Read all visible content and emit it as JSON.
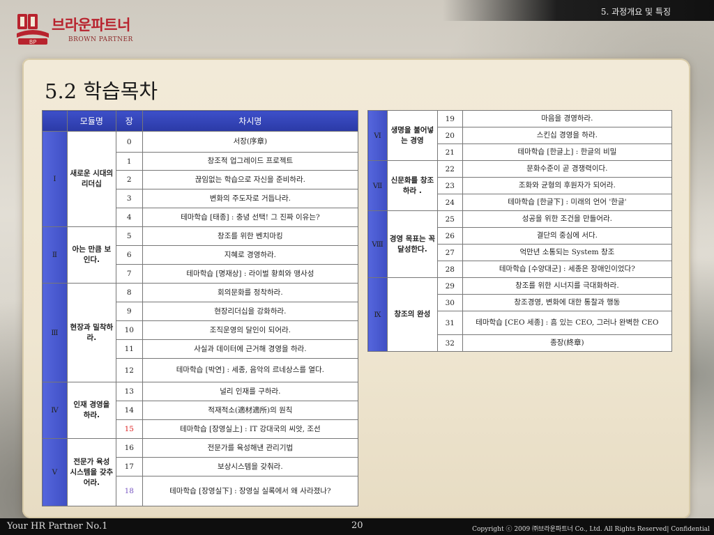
{
  "header": {
    "section_label": "5. 과정개요 및 특징",
    "logo_text_ko": "브라운파트너",
    "logo_text_en": "BROWN PARTNER",
    "logo_mark_text": "BP"
  },
  "page_title": "5.2 학습목차",
  "colors": {
    "header_blue": "#2b3aa6",
    "roman_blue": "#4a5bd3",
    "highlight_red": "#dd2222",
    "highlight_violet": "#7a59c2",
    "logo_red": "#b8232e"
  },
  "table_headers": {
    "module": "모듈명",
    "chapter": "장",
    "title": "차시명"
  },
  "modules": [
    {
      "numeral": "Ⅰ",
      "name": "새로운 시대의 리더십",
      "chapters": [
        {
          "no": "0",
          "title": "서장(序章)"
        },
        {
          "no": "1",
          "title": "창조적 업그레이드 프로젝트"
        },
        {
          "no": "2",
          "title": "끊임없는 학습으로 자신을 준비하라."
        },
        {
          "no": "3",
          "title": "변화의 주도자로 거듭나라."
        },
        {
          "no": "4",
          "title": "테마학습 [태종] : 충녕 선택! 그 진짜 이유는?"
        }
      ]
    },
    {
      "numeral": "Ⅱ",
      "name": "아는 만큼 보인다.",
      "chapters": [
        {
          "no": "5",
          "title": "창조를 위한 벤치마킹"
        },
        {
          "no": "6",
          "title": "지혜로 경영하라."
        },
        {
          "no": "7",
          "title": "테마학습 [명재상] : 라이벌 황희와 맹사성"
        }
      ]
    },
    {
      "numeral": "Ⅲ",
      "name": "현장과 밀착하라.",
      "chapters": [
        {
          "no": "8",
          "title": "회의문화를 정착하라."
        },
        {
          "no": "9",
          "title": "현장리더십을 강화하라."
        },
        {
          "no": "10",
          "title": "조직운영의 달인이 되어라."
        },
        {
          "no": "11",
          "title": "사실과 데이터에 근거해 경영을 하라."
        },
        {
          "no": "12",
          "title": "테마학습 [박연] : 세종, 음악의 르네상스를 열다."
        }
      ]
    },
    {
      "numeral": "Ⅳ",
      "name": "인재 경영을 하라.",
      "chapters": [
        {
          "no": "13",
          "title": "널리 인재를 구하라."
        },
        {
          "no": "14",
          "title": "적재적소(適材適所)의 원칙"
        },
        {
          "no": "15",
          "title": "테마학습 [장영실上] : IT 강대국의 씨앗, 조선",
          "color": "red"
        }
      ]
    },
    {
      "numeral": "Ⅴ",
      "name": "전문가 육성 시스템을 갖추어라.",
      "chapters": [
        {
          "no": "16",
          "title": "전문가를 육성해낸 관리기법"
        },
        {
          "no": "17",
          "title": "보상시스템을 갖춰라."
        },
        {
          "no": "18",
          "title": "테마학습 [장영실下] : 장영실 실록에서 왜 사라졌나?",
          "color": "violet"
        }
      ]
    },
    {
      "numeral": "Ⅵ",
      "name": "생명을 불어넣는 경영",
      "chapters": [
        {
          "no": "19",
          "title": "마음을 경영하라."
        },
        {
          "no": "20",
          "title": "스킨십 경영을 하라."
        },
        {
          "no": "21",
          "title": "테마학습 [한글上] : 한글의 비밀"
        }
      ]
    },
    {
      "numeral": "Ⅶ",
      "name": "신문화를 창조하라 .",
      "chapters": [
        {
          "no": "22",
          "title": "문화수준이 곧 경쟁력이다."
        },
        {
          "no": "23",
          "title": "조화와 균형의 후원자가 되어라."
        },
        {
          "no": "24",
          "title": "테마학습 [한글下] : 미래의 언어 '한글'"
        }
      ]
    },
    {
      "numeral": "Ⅷ",
      "name": "경영 목표는 꼭 달성한다.",
      "chapters": [
        {
          "no": "25",
          "title": "성공을 위한 조건을 만들어라."
        },
        {
          "no": "26",
          "title": "결단의 중심에 서다."
        },
        {
          "no": "27",
          "title": "억만년 소통되는 System 창조"
        },
        {
          "no": "28",
          "title": "테마학습 [수양대군] : 세종은 장애인이었다?"
        }
      ]
    },
    {
      "numeral": "Ⅸ",
      "name": "창조의 완성",
      "chapters": [
        {
          "no": "29",
          "title": "창조를 위한 시너지를 극대화하라."
        },
        {
          "no": "30",
          "title": "창조경영, 변화에 대한 통찰과 행동"
        },
        {
          "no": "31",
          "title": "테마학습 [CEO 세종] : 흠 있는 CEO, 그러나 완벽한 CEO"
        },
        {
          "no": "32",
          "title": "종장(終章)"
        }
      ]
    }
  ],
  "footer": {
    "left": "Your HR Partner No.1",
    "page": "20",
    "right": "Copyright ⓒ 2009 ㈜브라운파트너 Co., Ltd. All Rights Reserved| Confidential"
  }
}
